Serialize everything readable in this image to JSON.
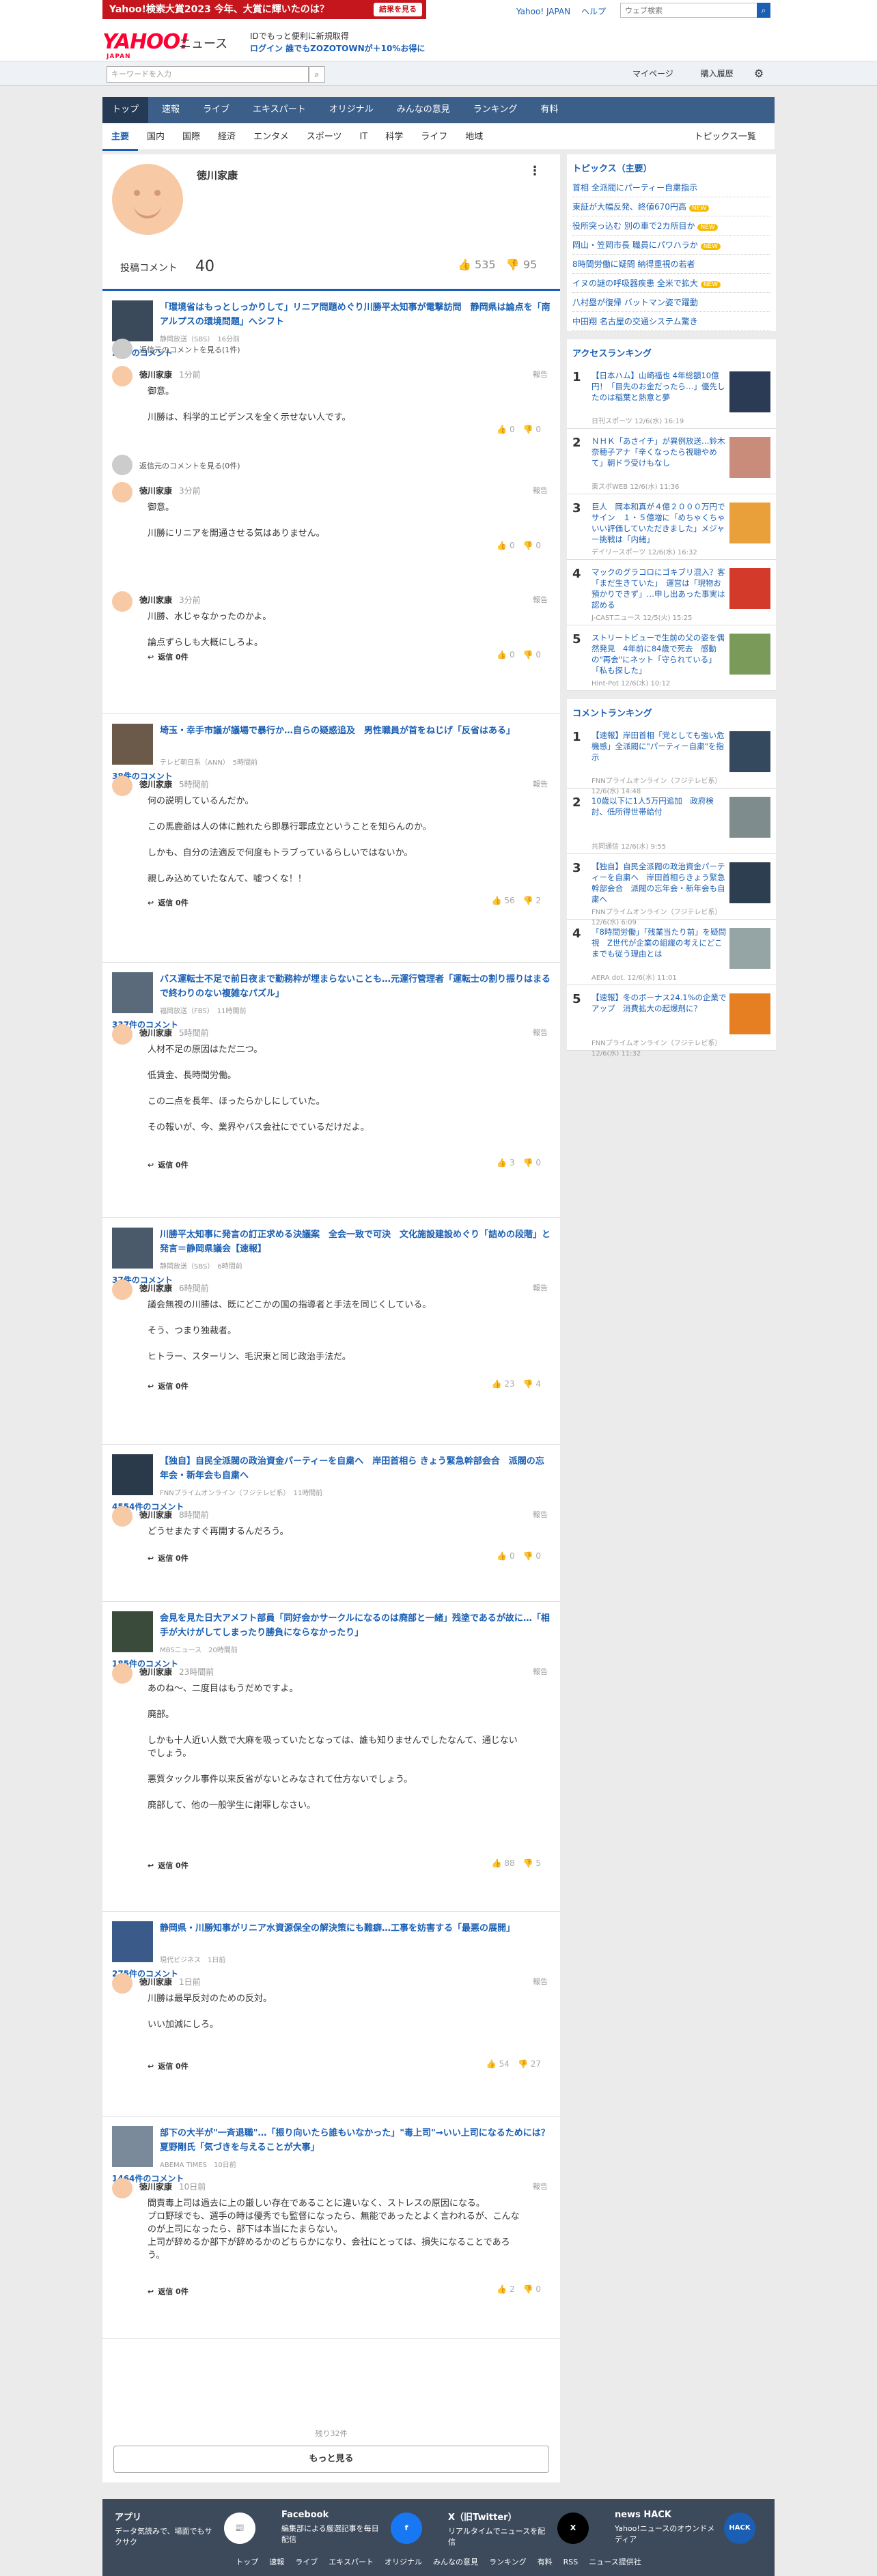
{
  "topbar": {
    "promo": "Yahoo!検索大賞2023 今年、大賞に輝いたのは？",
    "promo_btn": "結果を見る",
    "links": [
      "Yahoo! JAPAN",
      "ヘルプ"
    ],
    "search_placeholder": "ウェブ検索"
  },
  "header": {
    "logo": "YAHOO!",
    "logo_sub": "JAPAN",
    "section": "ニュース",
    "line1": "IDでもっと便利に新規取得",
    "line2": "ログイン 誰でもZOZOTOWNが＋10%お得に"
  },
  "searchbar": {
    "placeholder": "キーワードを入力",
    "mypage": "マイページ",
    "purchase": "購入履歴"
  },
  "nav": [
    "トップ",
    "速報",
    "ライブ",
    "エキスパート",
    "オリジナル",
    "みんなの意見",
    "ランキング",
    "有料"
  ],
  "subnav": [
    "主要",
    "国内",
    "国際",
    "経済",
    "エンタメ",
    "スポーツ",
    "IT",
    "科学",
    "ライフ",
    "地域"
  ],
  "subnav_right": "トピックス一覧",
  "profile": {
    "name": "徳川家康",
    "stat_label": "投稿コメント",
    "stat_count": "40",
    "likes": "535",
    "dislikes": "95"
  },
  "articles": [
    {
      "title": "「環境省はもっとしっかりして」リニア問題めぐり川勝平太知事が電撃訪問　静岡県は論点を「南アルプスの環境問題」へシフト",
      "source": "静岡放送（SBS）　16分前",
      "count": "20件のコメント",
      "comments": [
        {
          "pre": "返信元のコメントを見る(1件)",
          "name": "徳川家康",
          "time": "1分前",
          "body": "御意。\n\n川勝は、科学的エビデンスを全く示せない人です。",
          "like": "0",
          "dislike": "0"
        },
        {
          "pre": "返信元のコメントを見る(0件)",
          "name": "徳川家康",
          "time": "3分前",
          "body": "御意。\n\n川勝にリニアを開通させる気はありません。",
          "like": "0",
          "dislike": "0"
        },
        {
          "pre": "",
          "name": "徳川家康",
          "time": "3分前",
          "body": "川勝、水じゃなかったのかよ。\n\n論点ずらしも大概にしろよ。",
          "like": "0",
          "dislike": "0",
          "reply": "返信 0件"
        }
      ]
    },
    {
      "title": "埼玉・幸手市議が議場で暴行か…自らの疑惑追及　男性職員が首をねじげ「反省はある」",
      "source": "テレビ朝日系（ANN）　5時間前",
      "count": "38件のコメント",
      "comments": [
        {
          "pre": "",
          "name": "徳川家康",
          "time": "5時間前",
          "body": "何の説明しているんだか。\n\nこの馬鹿爺は人の体に触れたら即暴行罪成立ということを知らんのか。\n\nしかも、自分の法適反で何度もトラブっているらしいではないか。\n\n親しみ込めていたなんて、嘘つくな！！",
          "like": "56",
          "dislike": "2",
          "reply": "返信 0件"
        }
      ]
    },
    {
      "title": "バス運転士不足で前日夜まで勤務枠が埋まらないことも…元運行管理者「運転士の割り振りはまるで終わりのない複雑なパズル」",
      "source": "福岡放送（FBS）　11時間前",
      "count": "337件のコメント",
      "comments": [
        {
          "pre": "",
          "name": "徳川家康",
          "time": "5時間前",
          "body": "人材不足の原因はただ二つ。\n\n低賃金、長時間労働。\n\nこの二点を長年、ほったらかしにしていた。\n\nその報いが、今、業界やバス会社にでているだけだよ。",
          "like": "3",
          "dislike": "0",
          "reply": "返信 0件"
        }
      ]
    },
    {
      "title": "川勝平太知事に発言の訂正求める決議案　全会一致で可決　文化施設建設めぐり「詰めの段階」と発言＝静岡県議会【速報】",
      "source": "静岡放送（SBS）　6時間前",
      "count": "37件のコメント",
      "comments": [
        {
          "pre": "",
          "name": "徳川家康",
          "time": "6時間前",
          "body": "議会無視の川勝は、既にどこかの国の指導者と手法を同じくしている。\n\nそう、つまり独裁者。\n\nヒトラー、スターリン、毛沢東と同じ政治手法だ。",
          "like": "23",
          "dislike": "4",
          "reply": "返信 0件"
        }
      ]
    },
    {
      "title": "【独自】自民全派閥の政治資金パーティーを自粛へ　岸田首相ら きょう緊急幹部会合　派閥の忘年会・新年会も自粛へ",
      "source": "FNNプライムオンライン（フジテレビ系）　11時間前",
      "count": "4554件のコメント",
      "comments": [
        {
          "pre": "",
          "name": "徳川家康",
          "time": "8時間前",
          "body": "どうせまたすぐ再開するんだろう。",
          "like": "0",
          "dislike": "0",
          "reply": "返信 0件"
        }
      ]
    },
    {
      "title": "会見を見た日大アメフト部員「同好会かサークルになるのは廃部と一緒」残塗であるが故に…「相手が大けがしてしまったり勝負にならなかったり」",
      "source": "MBSニュース　20時間前",
      "count": "185件のコメント",
      "comments": [
        {
          "pre": "",
          "name": "徳川家康",
          "time": "23時間前",
          "body": "あのね～、二度目はもうだめですよ。\n\n廃部。\n\nしかも十人近い人数で大麻を吸っていたとなっては、誰も知りませんでしたなんて、通じないでしょう。\n\n悪質タックル事件以来反省がないとみなされて仕方ないでしょう。\n\n廃部して、他の一般学生に謝罪しなさい。",
          "like": "88",
          "dislike": "5",
          "reply": "返信 0件"
        }
      ]
    },
    {
      "title": "静岡県・川勝知事がリニア水資源保全の解決策にも難癖…工事を妨害する「最悪の展開」",
      "source": "現代ビジネス　1日前",
      "count": "275件のコメント",
      "comments": [
        {
          "pre": "",
          "name": "徳川家康",
          "time": "1日前",
          "body": "川勝は最早反対のための反対。\n\nいい加減にしろ。",
          "like": "54",
          "dislike": "27",
          "reply": "返信 0件"
        }
      ]
    },
    {
      "title": "部下の大半が\"一斉退職\"…「振り向いたら誰もいなかった」\"毒上司\"→いい上司になるためには？夏野剛氏「気づきを与えることが大事」",
      "source": "ABEMA TIMES　10日前",
      "count": "1464件のコメント",
      "comments": [
        {
          "pre": "",
          "name": "徳川家康",
          "time": "10日前",
          "body": "間責毒上司は過去に上の厳しい存在であることに違いなく、ストレスの原因になる。\nプロ野球でも、選手の時は優秀でも監督になったら、無能であったとよく言われるが、こんなのが上司になったら、部下は本当にたまらない。\n上司が辞めるか部下が辞めるかのどちらかになり、会社にとっては、損失になることであろう。",
          "like": "2",
          "dislike": "0",
          "reply": "返信 0件"
        }
      ]
    }
  ],
  "pager": {
    "remaining": "残り32件",
    "more": "もっと見る"
  },
  "topics": {
    "heading": "トピックス（主要）",
    "items": [
      {
        "text": "首相 全派閥にパーティー自粛指示",
        "badge": ""
      },
      {
        "text": "東証が大幅反発、終値670円高",
        "badge": "NEW"
      },
      {
        "text": "役所突っ込む 別の車で2カ所目か",
        "badge": "NEW"
      },
      {
        "text": "岡山・笠岡市長 職員にパワハラか",
        "badge": "NEW"
      },
      {
        "text": "8時間労働に疑問 納得重視の若者",
        "badge": ""
      },
      {
        "text": "イヌの謎の呼吸器疾患 全米で拡大",
        "badge": "NEW"
      },
      {
        "text": "八村塁が復帰 バットマン姿で躍動",
        "badge": ""
      },
      {
        "text": "中田翔 名古屋の交通システム驚き",
        "badge": ""
      }
    ]
  },
  "access_ranking": {
    "heading": "アクセスランキング",
    "items": [
      {
        "num": "1",
        "title": "【日本ハム】山崎福也 4年総額10億円！「目先のお金だったら…」優先したのは稲葉と熱意と夢",
        "src": "日刊スポーツ 12/6(水) 16:19"
      },
      {
        "num": "2",
        "title": "ＮＨＫ「あさイチ」が異例放送…鈴木奈穂子アナ「辛くなったら視聴やめて」朝ドラ受けもなし",
        "src": "東スポWEB 12/6(水) 11:36"
      },
      {
        "num": "3",
        "title": "巨人　岡本和真が４億２０００万円でサイン　１・５億増に「めちゃくちゃいい評価していただきました」メジャー挑戦は「内緒」",
        "src": "デイリースポーツ 12/6(水) 16:32"
      },
      {
        "num": "4",
        "title": "マックのグラコロにゴキブリ混入？客「まだ生きていた」　運営は「現物お預かりできず」…申し出あった事実は認める",
        "src": "J-CASTニュース 12/5(火) 15:25"
      },
      {
        "num": "5",
        "title": "ストリートビューで生前の父の姿を偶然発見　4年前に84歳で死去　感動の\"再会\"にネット「守られている」「私も探した」",
        "src": "Hint-Pot 12/6(水) 10:12"
      }
    ]
  },
  "comment_ranking": {
    "heading": "コメントランキング",
    "items": [
      {
        "num": "1",
        "title": "【速報】岸田首相「党としても強い危機感」全派閥に\"パーティー自粛\"を指示",
        "src": "FNNプライムオンライン（フジテレビ系） 12/6(水) 14:48"
      },
      {
        "num": "2",
        "title": "10歳以下に1人5万円追加　政府検討、低所得世帯給付",
        "src": "共同通信 12/6(水) 9:55"
      },
      {
        "num": "3",
        "title": "【独自】自民全派閥の政治資金パーティーを自粛へ　岸田首相らきょう緊急幹部会合　派閥の忘年会・新年会も自粛へ",
        "src": "FNNプライムオンライン（フジテレビ系） 12/6(水) 6:09"
      },
      {
        "num": "4",
        "title": "「8時間労働」「残業当たり前」を疑問視　Z世代が企業の組織の考えにどこまでも従う理由とは",
        "src": "AERA dot. 12/6(水) 11:01"
      },
      {
        "num": "5",
        "title": "【速報】冬のボーナス24.1%の企業でアップ　消費拡大の起爆剤に？",
        "src": "FNNプライムオンライン（フジテレビ系） 12/6(水) 11:32"
      }
    ]
  },
  "footer": {
    "items": [
      {
        "title": "アプリ",
        "text": "データ気読みで、場面でもサクサク"
      },
      {
        "title": "Facebook",
        "text": "編集部による厳選記事を毎日配信"
      },
      {
        "title": "X（旧Twitter）",
        "text": "リアルタイムでニュースを配信"
      },
      {
        "title": "news HACK",
        "text": "Yahoo!ニュースのオウンドメディア"
      }
    ],
    "links": [
      "トップ",
      "速報",
      "ライブ",
      "エキスパート",
      "オリジナル",
      "みんなの意見",
      "ランキング",
      "有料",
      "RSS",
      "ニュース提供社"
    ]
  }
}
